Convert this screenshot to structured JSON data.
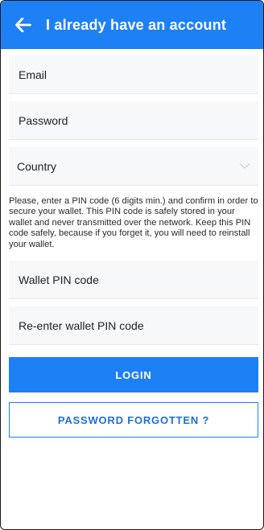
{
  "header": {
    "title": "I already have an account",
    "back_icon": "arrow-left-icon"
  },
  "form": {
    "email_placeholder": "Email",
    "password_placeholder": "Password",
    "country_label": "Country",
    "country_icon": "chevron-down-icon",
    "pin_info": "Please, enter a PIN code (6 digits min.) and confirm in order to secure your wallet. This PIN code is safely stored in your wallet and never transmitted over the network. Keep this PIN code safely, because if you forget it, you will need to reinstall your wallet.",
    "pin_placeholder": "Wallet PIN code",
    "pin_confirm_placeholder": "Re-enter wallet PIN code"
  },
  "actions": {
    "login_label": "LOGIN",
    "forgot_label": "PASSWORD FORGOTTEN ?"
  },
  "colors": {
    "primary": "#1e80f5",
    "field_bg": "#f7f8fa"
  }
}
